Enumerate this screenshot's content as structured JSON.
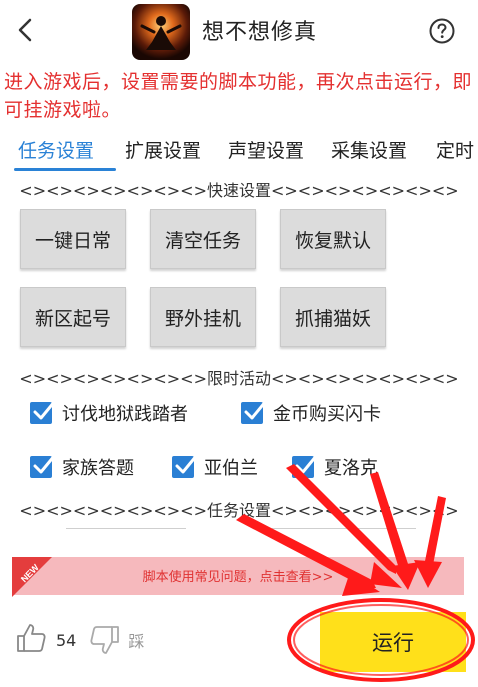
{
  "header": {
    "title": "想不想修真",
    "back_icon": "chevron-left-icon",
    "help_icon": "question-circle-icon"
  },
  "notice": "进入游戏后，设置需要的脚本功能，再次点击运行，即可挂游戏啦。",
  "tabs": [
    {
      "label": "任务设置",
      "active": true
    },
    {
      "label": "扩展设置",
      "active": false
    },
    {
      "label": "声望设置",
      "active": false
    },
    {
      "label": "采集设置",
      "active": false
    },
    {
      "label": "定时",
      "active": false
    }
  ],
  "sections": {
    "quick": "<><><><><><><>快速设置<><><><><><><>",
    "limited": "<><><><><><><>限时活动<><><><><><><>",
    "task": "<><><><><><><>任务设置<><><><><><><>"
  },
  "quick_buttons": [
    "一键日常",
    "清空任务",
    "恢复默认",
    "新区起号",
    "野外挂机",
    "抓捕猫妖"
  ],
  "events": [
    {
      "label": "讨伐地狱践踏者",
      "checked": true
    },
    {
      "label": "金币购买闪卡",
      "checked": true
    },
    {
      "label": "家族答题",
      "checked": true
    },
    {
      "label": "亚伯兰",
      "checked": true
    },
    {
      "label": "夏洛克",
      "checked": true
    }
  ],
  "banner": {
    "tag": "NEW",
    "text": "脚本使用常见问题，点击查看>>"
  },
  "footer": {
    "like_count": "54",
    "dislike_label": "踩",
    "run_label": "运行"
  },
  "colors": {
    "accent": "#2a82d6",
    "notice": "#e43030",
    "run_button": "#ffe01a",
    "banner_bg": "#f6b9bd",
    "annotation": "#ff1a1a"
  }
}
